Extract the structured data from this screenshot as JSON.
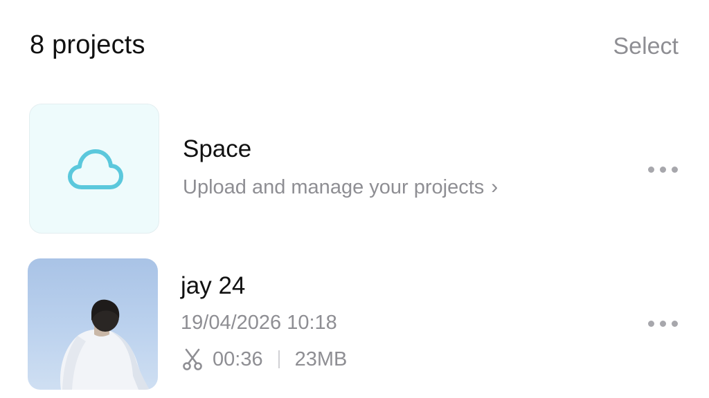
{
  "header": {
    "title": "8 projects",
    "select_label": "Select"
  },
  "space_row": {
    "icon": "cloud-icon",
    "title": "Space",
    "subtitle": "Upload and manage your projects",
    "chevron": "›",
    "accent_color": "#5bc8dc"
  },
  "projects": [
    {
      "title": "jay 24",
      "date": "19/04/2026 10:18",
      "duration": "00:36",
      "size": "23MB",
      "duration_icon": "scissors-icon"
    }
  ]
}
